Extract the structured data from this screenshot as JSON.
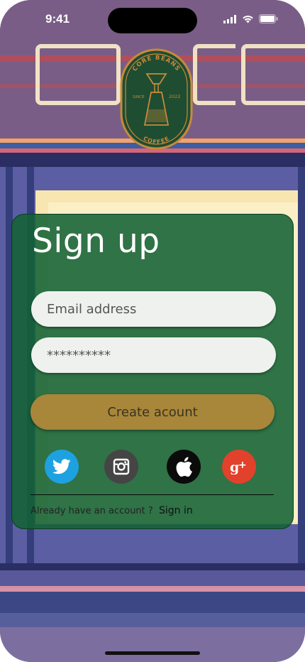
{
  "status_bar": {
    "time": "9:41"
  },
  "logo": {
    "brand_top": "CORE BEANS",
    "brand_bottom": "COFFEE",
    "since_label": "SINCE",
    "year": "2022",
    "colors": {
      "badge": "#1f4d32",
      "ring": "#c88a3a"
    }
  },
  "signup": {
    "title": "Sign up",
    "email_placeholder": "Email address",
    "password_value": "**********",
    "create_button": "Create acount",
    "social": [
      {
        "name": "twitter",
        "icon": "twitter-icon",
        "color": "#1da1e0"
      },
      {
        "name": "instagram",
        "icon": "instagram-icon",
        "color": "#454545"
      },
      {
        "name": "apple",
        "icon": "apple-icon",
        "color": "#0b0b0b"
      },
      {
        "name": "google-plus",
        "icon": "google-plus-icon",
        "color": "#e2412b"
      }
    ],
    "already_text": "Already have an account ?",
    "signin_link": "Sign in"
  },
  "colors": {
    "card": "#126234",
    "button": "#a8863a",
    "field": "#eef1ee"
  }
}
